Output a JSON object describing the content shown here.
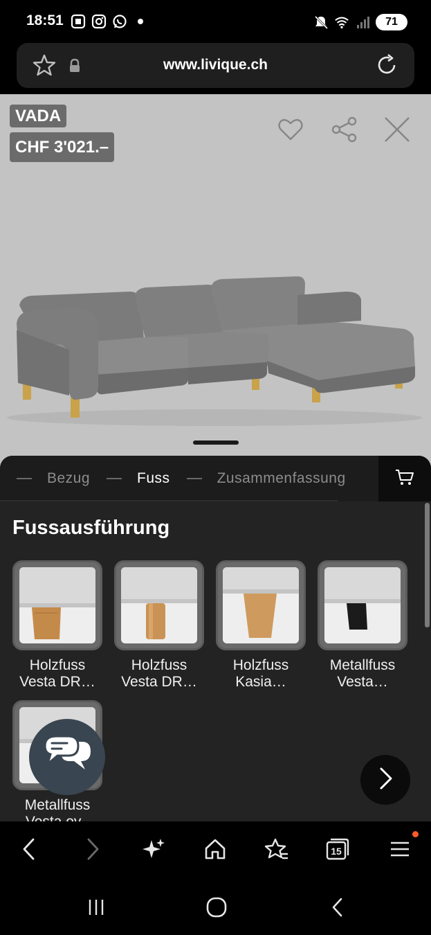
{
  "status": {
    "time": "18:51",
    "battery": "71"
  },
  "browser": {
    "url": "www.livique.ch"
  },
  "product": {
    "name": "VADA",
    "price": "CHF 3'021.–"
  },
  "tabs": [
    {
      "label": "Bezug",
      "active": false
    },
    {
      "label": "Fuss",
      "active": true
    },
    {
      "label": "Zusammenfassung",
      "active": false
    }
  ],
  "section": {
    "title": "Fussausführung"
  },
  "options": [
    {
      "line1": "Holzfuss",
      "line2": "Vesta DR…",
      "leg": "oak-block"
    },
    {
      "line1": "Holzfuss",
      "line2": "Vesta DR…",
      "leg": "oak-round"
    },
    {
      "line1": "Holzfuss",
      "line2": "Kasia…",
      "leg": "oak-tapered"
    },
    {
      "line1": "Metallfuss",
      "line2": "Vesta…",
      "leg": "black-metal"
    },
    {
      "line1": "Metallfuss",
      "line2": "Vesta ov–",
      "leg": "metal"
    }
  ],
  "colors": {
    "accent_dot": "#ff5a2a",
    "hero_bg": "#c3c3c3",
    "sheet_bg": "#232323"
  }
}
